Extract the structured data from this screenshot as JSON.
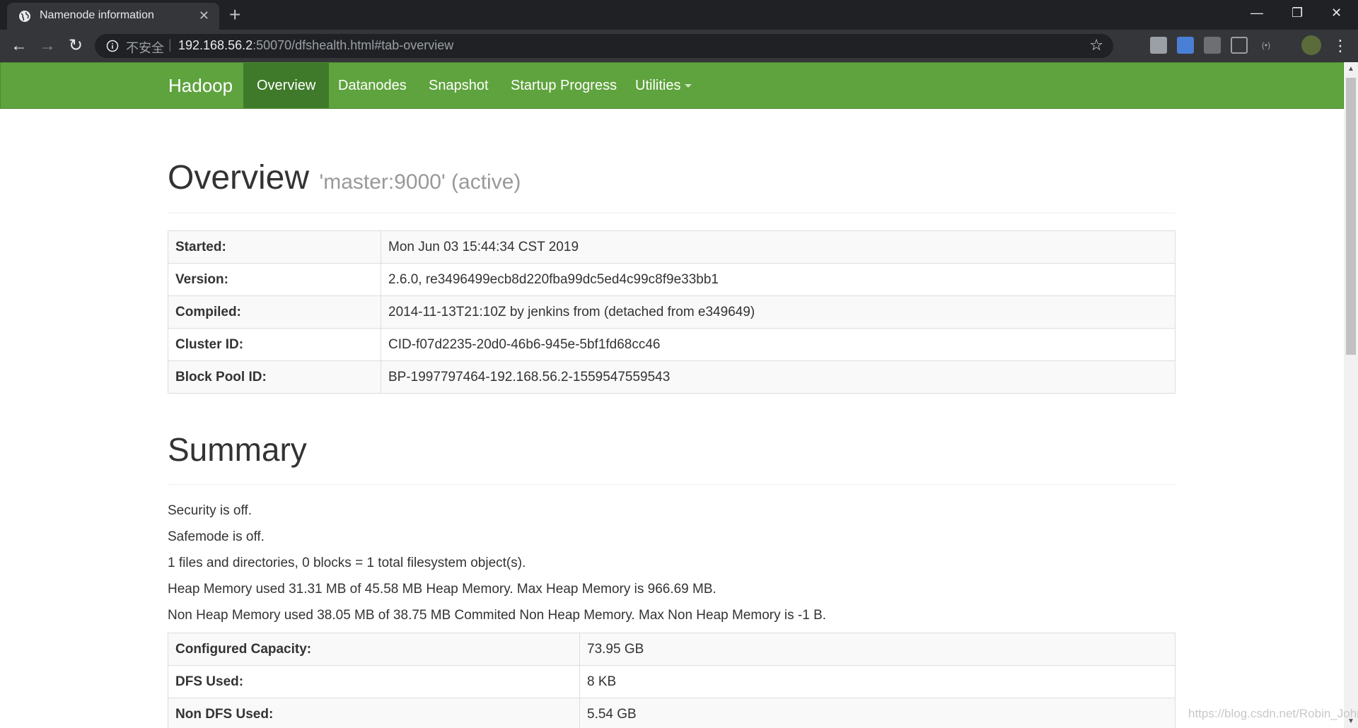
{
  "browser": {
    "tab_title": "Namenode information",
    "security_label": "不安全",
    "url_host": "192.168.56.2",
    "url_rest": ":50070/dfshealth.html#tab-overview"
  },
  "navbar": {
    "brand": "Hadoop",
    "items": [
      {
        "label": "Overview",
        "active": true
      },
      {
        "label": "Datanodes"
      },
      {
        "label": "Snapshot"
      },
      {
        "label": "Startup Progress"
      },
      {
        "label": "Utilities"
      }
    ]
  },
  "overview": {
    "title": "Overview",
    "subtitle": "'master:9000' (active)",
    "rows": [
      {
        "key": "Started:",
        "value": "Mon Jun 03 15:44:34 CST 2019"
      },
      {
        "key": "Version:",
        "value": "2.6.0, re3496499ecb8d220fba99dc5ed4c99c8f9e33bb1"
      },
      {
        "key": "Compiled:",
        "value": "2014-11-13T21:10Z by jenkins from (detached from e349649)"
      },
      {
        "key": "Cluster ID:",
        "value": "CID-f07d2235-20d0-46b6-945e-5bf1fd68cc46"
      },
      {
        "key": "Block Pool ID:",
        "value": "BP-1997797464-192.168.56.2-1559547559543"
      }
    ]
  },
  "summary": {
    "title": "Summary",
    "lines": [
      "Security is off.",
      "Safemode is off.",
      "1 files and directories, 0 blocks = 1 total filesystem object(s).",
      "Heap Memory used 31.31 MB of 45.58 MB Heap Memory. Max Heap Memory is 966.69 MB.",
      "Non Heap Memory used 38.05 MB of 38.75 MB Commited Non Heap Memory. Max Non Heap Memory is -1 B."
    ],
    "rows": [
      {
        "key": "Configured Capacity:",
        "value": "73.95 GB"
      },
      {
        "key": "DFS Used:",
        "value": "8 KB"
      },
      {
        "key": "Non DFS Used:",
        "value": "5.54 GB"
      }
    ]
  },
  "watermark": "https://blog.csdn.net/Robin_John",
  "colors": {
    "navbar": "#5fa33e",
    "navbar_active": "#3f7a2a",
    "chrome_dark": "#202124"
  }
}
